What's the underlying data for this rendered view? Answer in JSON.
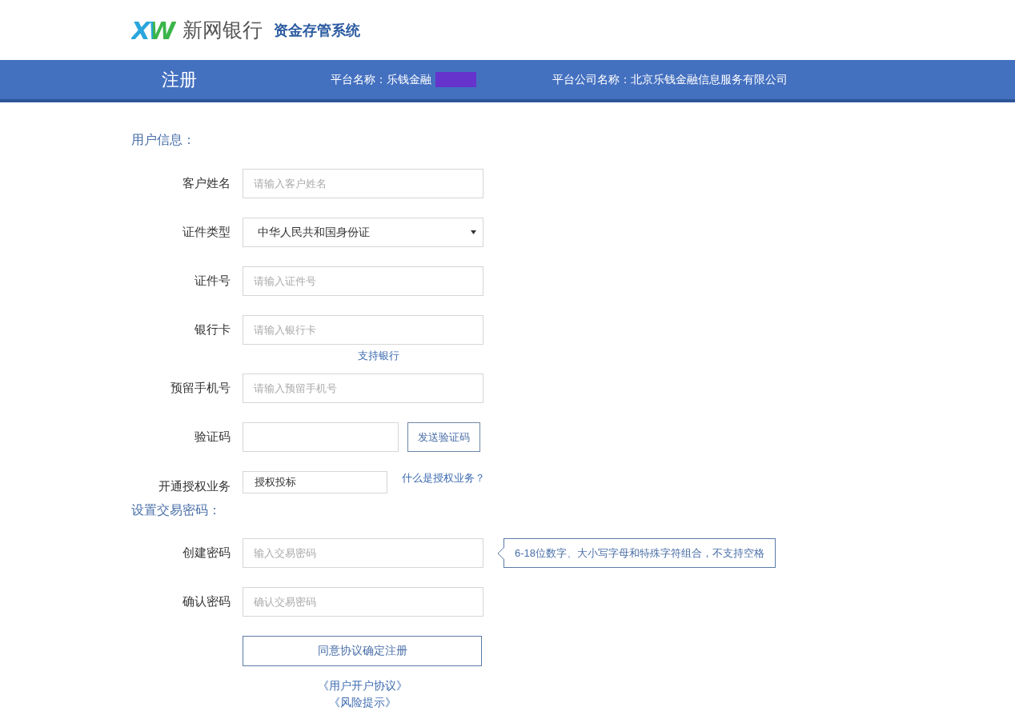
{
  "logo": {
    "mark": "XW",
    "bank_name": "新网银行",
    "system_name": "资金存管系统"
  },
  "banner": {
    "title": "注册",
    "platform_label": "平台名称：乐钱金融",
    "platform_redacted": true,
    "company_label": "平台公司名称：北京乐钱金融信息服务有限公司"
  },
  "sections": [
    {
      "title": "用户信息：",
      "rows": [
        {
          "kind": "text",
          "label": "客户姓名",
          "placeholder": "请输入客户姓名"
        },
        {
          "kind": "select",
          "label": "证件类型",
          "value": "中华人民共和国身份证"
        },
        {
          "kind": "text",
          "label": "证件号",
          "placeholder": "请输入证件号"
        },
        {
          "kind": "text",
          "label": "银行卡",
          "placeholder": "请输入银行卡",
          "link": "支持银行"
        },
        {
          "kind": "text",
          "label": "预留手机号",
          "placeholder": "请输入预留手机号"
        },
        {
          "kind": "code",
          "label": "验证码",
          "button": "发送验证码"
        },
        {
          "kind": "readonly",
          "label": "开通授权业务",
          "value": "授权投标",
          "link": "什么是授权业务？"
        }
      ]
    },
    {
      "title": "设置交易密码：",
      "rows": [
        {
          "kind": "password",
          "label": "创建密码",
          "placeholder": "输入交易密码",
          "hint": "6-18位数字、大小写字母和特殊字符组合，不支持空格"
        },
        {
          "kind": "password",
          "label": "确认密码",
          "placeholder": "确认交易密码"
        }
      ]
    }
  ],
  "submit": "同意协议确定注册",
  "links": [
    "《用户开户协议》",
    "《风险提示》"
  ]
}
